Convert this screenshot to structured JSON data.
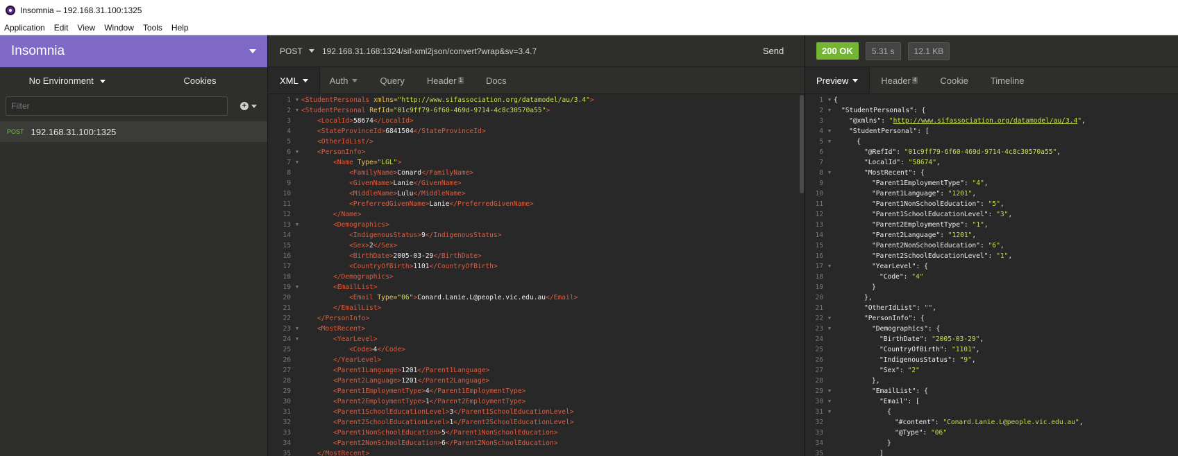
{
  "window": {
    "title": "Insomnia – 192.168.31.100:1325"
  },
  "menu": [
    "Application",
    "Edit",
    "View",
    "Window",
    "Tools",
    "Help"
  ],
  "sidebar": {
    "workspace": "Insomnia",
    "environment": "No Environment",
    "cookies": "Cookies",
    "filter_placeholder": "Filter",
    "request": {
      "method": "POST",
      "name": "192.168.31.100:1325"
    }
  },
  "request": {
    "method": "POST",
    "url": "192.168.31.168:1324/sif-xml2json/convert?wrap&sv=3.4.7",
    "send": "Send",
    "tabs": [
      {
        "label": "XML",
        "active": true
      },
      {
        "label": "Auth"
      },
      {
        "label": "Query"
      },
      {
        "label": "Header",
        "badge": "1"
      },
      {
        "label": "Docs"
      }
    ]
  },
  "response": {
    "status": "200 OK",
    "time": "5.31 s",
    "size": "12.1 KB",
    "tabs": [
      {
        "label": "Preview",
        "active": true
      },
      {
        "label": "Header",
        "badge": "4"
      },
      {
        "label": "Cookie"
      },
      {
        "label": "Timeline"
      }
    ]
  },
  "xml_lines": [
    "1|f|0|<StudentPersonals xmlns=\"http://www.sifassociation.org/datamodel/au/3.4\">",
    "2|f|0|<StudentPersonal RefId=\"01c9ff79-6f60-469d-9714-4c8c30570a55\">",
    "3||1|<LocalId>58674</LocalId>",
    "4||1|<StateProvinceId>6841504</StateProvinceId>",
    "5||1|<OtherIdList/>",
    "6|f|1|<PersonInfo>",
    "7|f|2|<Name Type=\"LGL\">",
    "8||3|<FamilyName>Conard</FamilyName>",
    "9||3|<GivenName>Lanie</GivenName>",
    "10||3|<MiddleName>Lulu</MiddleName>",
    "11||3|<PreferredGivenName>Lanie</PreferredGivenName>",
    "12||2|</Name>",
    "13|f|2|<Demographics>",
    "14||3|<IndigenousStatus>9</IndigenousStatus>",
    "15||3|<Sex>2</Sex>",
    "16||3|<BirthDate>2005-03-29</BirthDate>",
    "17||3|<CountryOfBirth>1101</CountryOfBirth>",
    "18||2|</Demographics>",
    "19|f|2|<EmailList>",
    "20||3|<Email Type=\"06\">Conard.Lanie.L@people.vic.edu.au</Email>",
    "21||2|</EmailList>",
    "22||1|</PersonInfo>",
    "23|f|1|<MostRecent>",
    "24|f|2|<YearLevel>",
    "25||3|<Code>4</Code>",
    "26||2|</YearLevel>",
    "27||2|<Parent1Language>1201</Parent1Language>",
    "28||2|<Parent2Language>1201</Parent2Language>",
    "29||2|<Parent1EmploymentType>4</Parent1EmploymentType>",
    "30||2|<Parent2EmploymentType>1</Parent2EmploymentType>",
    "31||2|<Parent1SchoolEducationLevel>3</Parent1SchoolEducationLevel>",
    "32||2|<Parent2SchoolEducationLevel>1</Parent2SchoolEducationLevel>",
    "33||2|<Parent1NonSchoolEducation>5</Parent1NonSchoolEducation>",
    "34||2|<Parent2NonSchoolEducation>6</Parent2NonSchoolEducation>",
    "35||1|</MostRecent>"
  ],
  "json_lines": [
    "1|f|0|{",
    "2|f|1|\"StudentPersonals\": {",
    "3||2|\"@xmlns\": \"http://www.sifassociation.org/datamodel/au/3.4\",",
    "4|f|2|\"StudentPersonal\": [",
    "5|f|3|{",
    "6||4|\"@RefId\": \"01c9ff79-6f60-469d-9714-4c8c30570a55\",",
    "7||4|\"LocalId\": \"58674\",",
    "8|f|4|\"MostRecent\": {",
    "9||5|\"Parent1EmploymentType\": \"4\",",
    "10||5|\"Parent1Language\": \"1201\",",
    "11||5|\"Parent1NonSchoolEducation\": \"5\",",
    "12||5|\"Parent1SchoolEducationLevel\": \"3\",",
    "13||5|\"Parent2EmploymentType\": \"1\",",
    "14||5|\"Parent2Language\": \"1201\",",
    "15||5|\"Parent2NonSchoolEducation\": \"6\",",
    "16||5|\"Parent2SchoolEducationLevel\": \"1\",",
    "17|f|5|\"YearLevel\": {",
    "18||6|\"Code\": \"4\"",
    "19||5|}",
    "20||4|},",
    "21||4|\"OtherIdList\": \"\",",
    "22|f|4|\"PersonInfo\": {",
    "23|f|5|\"Demographics\": {",
    "24||6|\"BirthDate\": \"2005-03-29\",",
    "25||6|\"CountryOfBirth\": \"1101\",",
    "26||6|\"IndigenousStatus\": \"9\",",
    "27||6|\"Sex\": \"2\"",
    "28||5|},",
    "29|f|5|\"EmailList\": {",
    "30|f|6|\"Email\": [",
    "31|f|7|{",
    "32||8|\"#content\": \"Conard.Lanie.L@people.vic.edu.au\",",
    "33||8|\"@Type\": \"06\"",
    "34||7|}",
    "35||6|]"
  ]
}
